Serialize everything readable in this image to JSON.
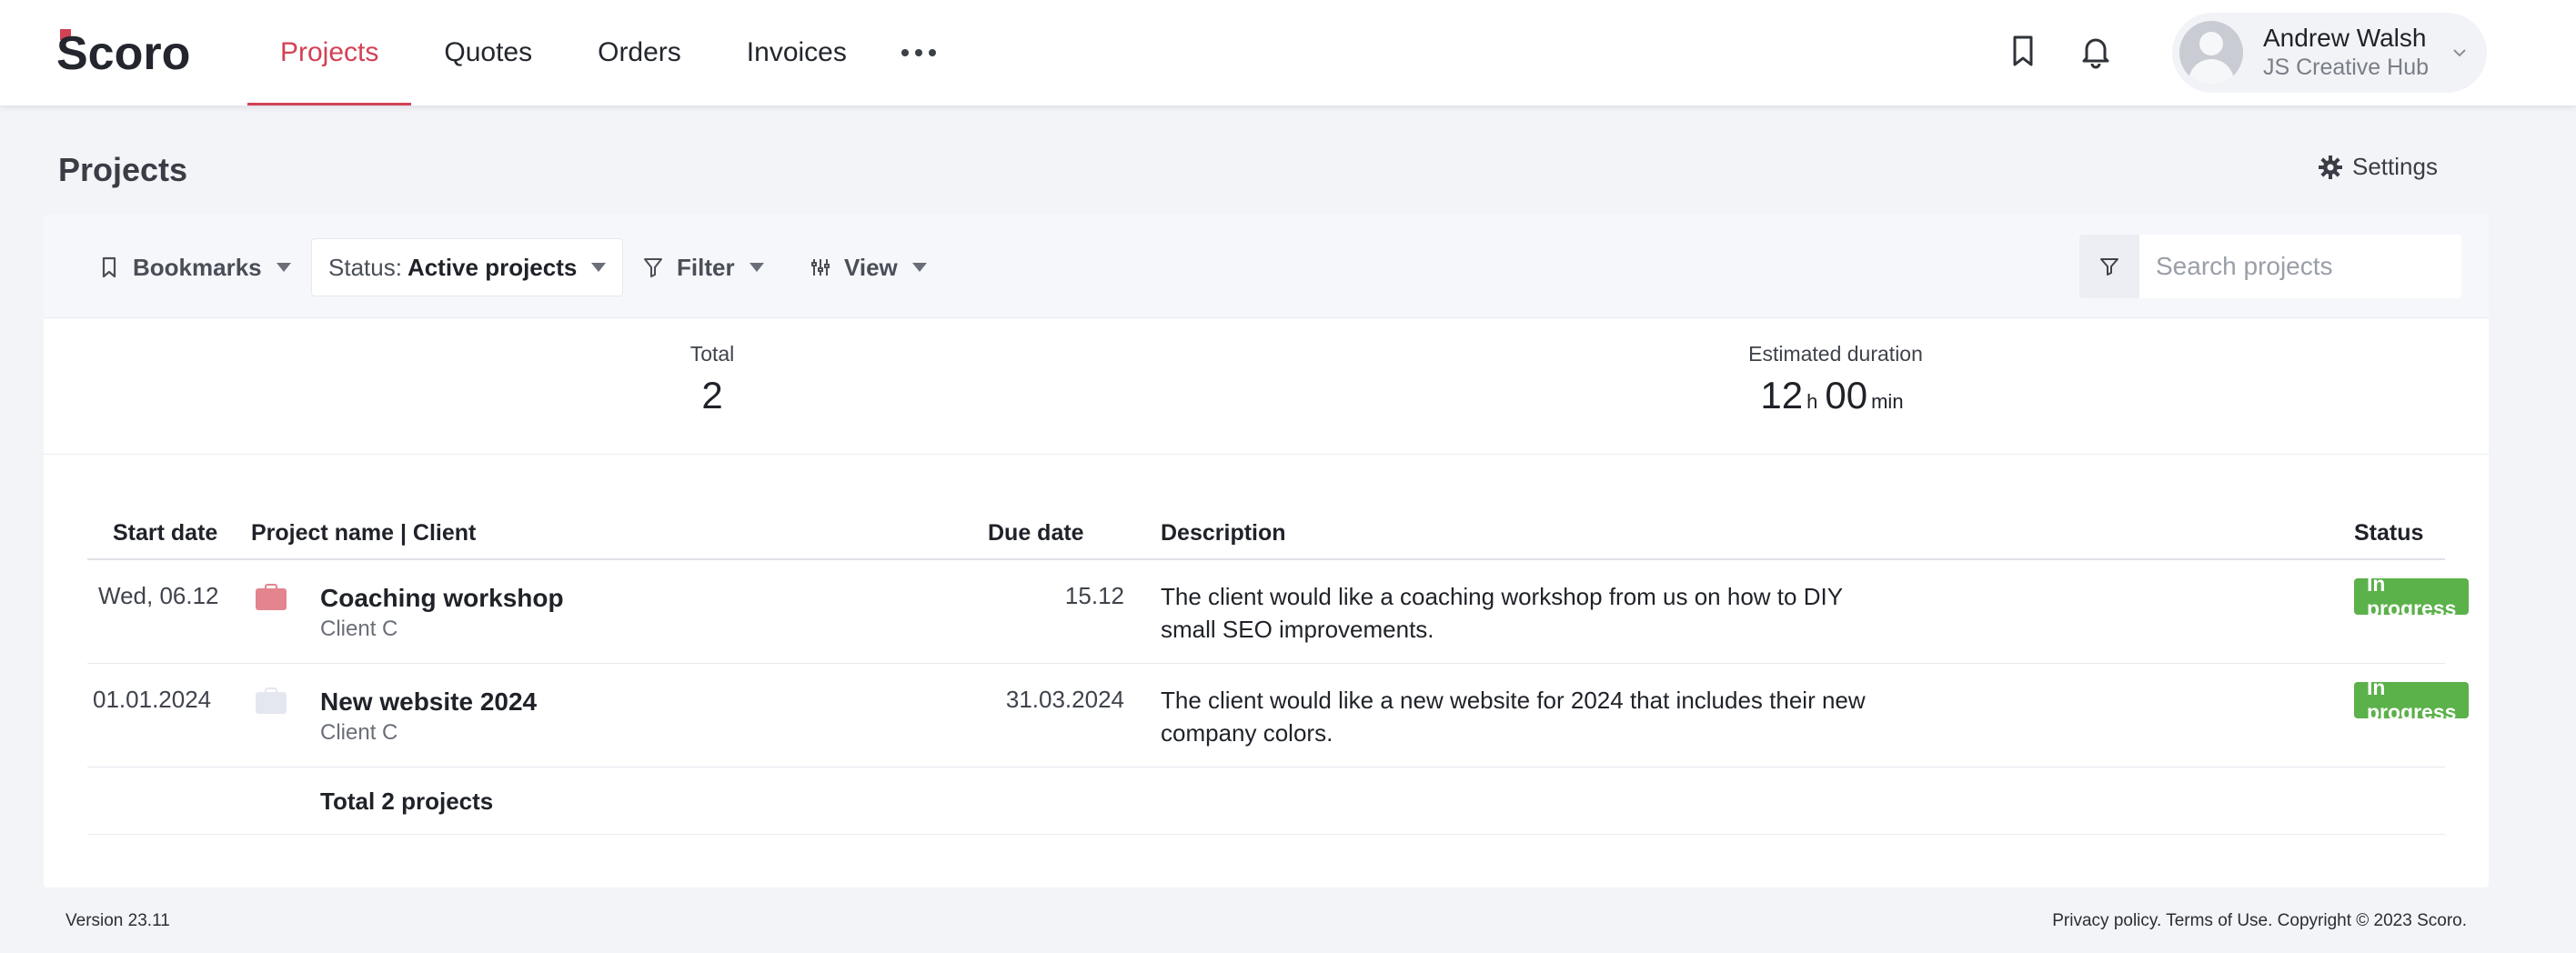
{
  "app": {
    "brand": "Scoro",
    "colors": {
      "accent": "#d24155",
      "status_green": "#5bb14a",
      "background": "#f3f4f8"
    }
  },
  "nav": {
    "items": [
      {
        "label": "Projects",
        "active": true
      },
      {
        "label": "Quotes",
        "active": false
      },
      {
        "label": "Orders",
        "active": false
      },
      {
        "label": "Invoices",
        "active": false
      }
    ],
    "more_icon": "more-dots-icon"
  },
  "header_icons": [
    "bookmark-icon",
    "bell-icon"
  ],
  "user": {
    "name": "Andrew Walsh",
    "company": "JS Creative Hub"
  },
  "page": {
    "title": "Projects",
    "settings_label": "Settings"
  },
  "toolbar": {
    "bookmarks_label": "Bookmarks",
    "status_prefix": "Status:",
    "status_value": "Active projects",
    "filter_label": "Filter",
    "view_label": "View",
    "search_placeholder": "Search projects",
    "search_value": ""
  },
  "summary": {
    "total_label": "Total",
    "total_value": "2",
    "duration_label": "Estimated duration",
    "duration_hours": "12",
    "hours_unit": "h",
    "duration_minutes": "00",
    "minutes_unit": "min"
  },
  "table": {
    "columns": [
      "Start date",
      "Project name | Client",
      "Due date",
      "Description",
      "Status"
    ],
    "rows": [
      {
        "start_date": "Wed, 06.12",
        "icon_color": "#e3848f",
        "name": "Coaching workshop",
        "client": "Client C",
        "due_date": "15.12",
        "description": "The client would like a coaching workshop from us on how to DIY small SEO improvements.",
        "status": "In progress"
      },
      {
        "start_date": "01.01.2024",
        "icon_color": "#e4e7ef",
        "name": "New website 2024",
        "client": "Client C",
        "due_date": "31.03.2024",
        "description": "The client would like a new website for 2024 that includes their new company colors.",
        "status": "In progress"
      }
    ],
    "total_label": "Total 2 projects"
  },
  "footer": {
    "version": "Version 23.11",
    "legal": "Privacy policy. Terms of Use. Copyright © 2023 Scoro."
  }
}
